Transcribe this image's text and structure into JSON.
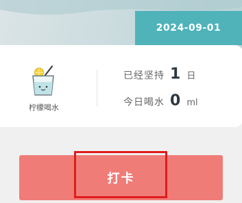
{
  "header": {
    "date": "2024-09-01"
  },
  "habit": {
    "name": "柠檬喝水",
    "icon": "lemon-water-glass-icon"
  },
  "stats": {
    "streak_label": "已经坚持",
    "streak_value": "1",
    "streak_unit": "日",
    "today_label": "今日喝水",
    "today_value": "0",
    "today_unit": "ml"
  },
  "actions": {
    "checkin_label": "打卡"
  },
  "colors": {
    "accent_teal": "#4fb3b9",
    "button_coral": "#f07c78",
    "highlight_red": "#e01b1b"
  }
}
